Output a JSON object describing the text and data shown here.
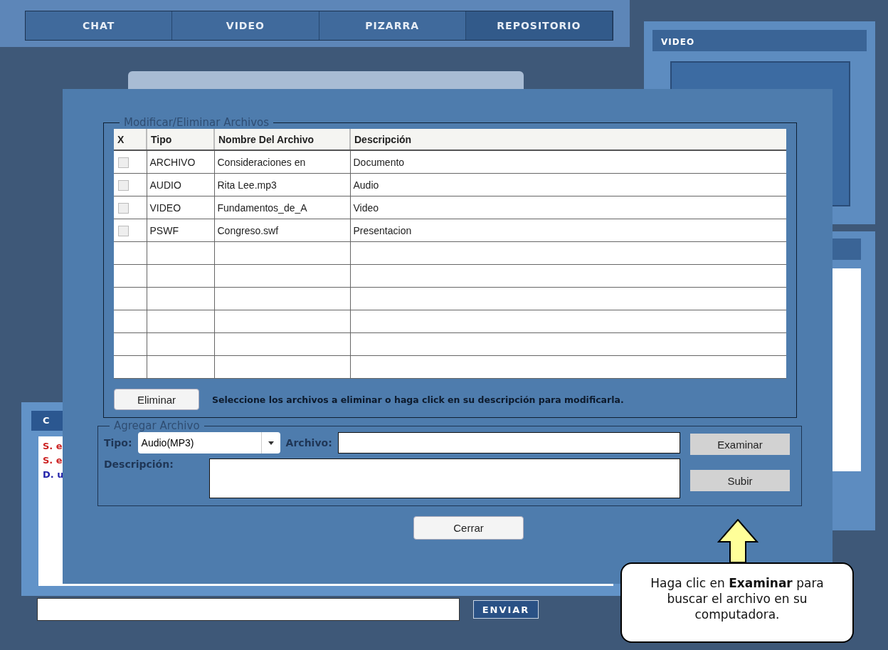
{
  "nav": {
    "tabs": [
      {
        "label": "CHAT",
        "selected": false
      },
      {
        "label": "VIDEO",
        "selected": false
      },
      {
        "label": "PIZARRA",
        "selected": false
      },
      {
        "label": "REPOSITORIO",
        "selected": true
      }
    ]
  },
  "video_panel": {
    "title": "VIDEO"
  },
  "chat_panel": {
    "title": "C",
    "messages": [
      {
        "text": "S. e",
        "color": "#cc2222"
      },
      {
        "text": "S. e",
        "color": "#cc2222"
      },
      {
        "text": "D. u",
        "color": "#2222aa"
      }
    ],
    "send_button": "ENVIAR"
  },
  "dialog": {
    "modify_section": {
      "legend": "Modificar/Eliminar Archivos",
      "columns": [
        "X",
        "Tipo",
        "Nombre Del Archivo",
        "Descripción"
      ],
      "rows": [
        {
          "checked": false,
          "tipo": "ARCHIVO",
          "nombre": "Consideraciones en",
          "descripcion": "Documento"
        },
        {
          "checked": false,
          "tipo": "AUDIO",
          "nombre": "Rita Lee.mp3",
          "descripcion": "Audio"
        },
        {
          "checked": false,
          "tipo": "VIDEO",
          "nombre": "Fundamentos_de_A",
          "descripcion": "Video"
        },
        {
          "checked": false,
          "tipo": "PSWF",
          "nombre": "Congreso.swf",
          "descripcion": "Presentacion"
        }
      ],
      "delete_button": "Eliminar",
      "hint": "Seleccione los archivos a eliminar o haga click en su descripción para modificarla."
    },
    "add_section": {
      "legend": "Agregar Archivo",
      "tipo_label": "Tipo:",
      "tipo_value": "Audio(MP3)",
      "archivo_label": "Archivo:",
      "descripcion_label": "Descripción:",
      "browse_button": "Examinar",
      "upload_button": "Subir"
    },
    "close_button": "Cerrar"
  },
  "callout": {
    "text": "Haga clic en **Examinar** para buscar el archivo en su computadora."
  }
}
